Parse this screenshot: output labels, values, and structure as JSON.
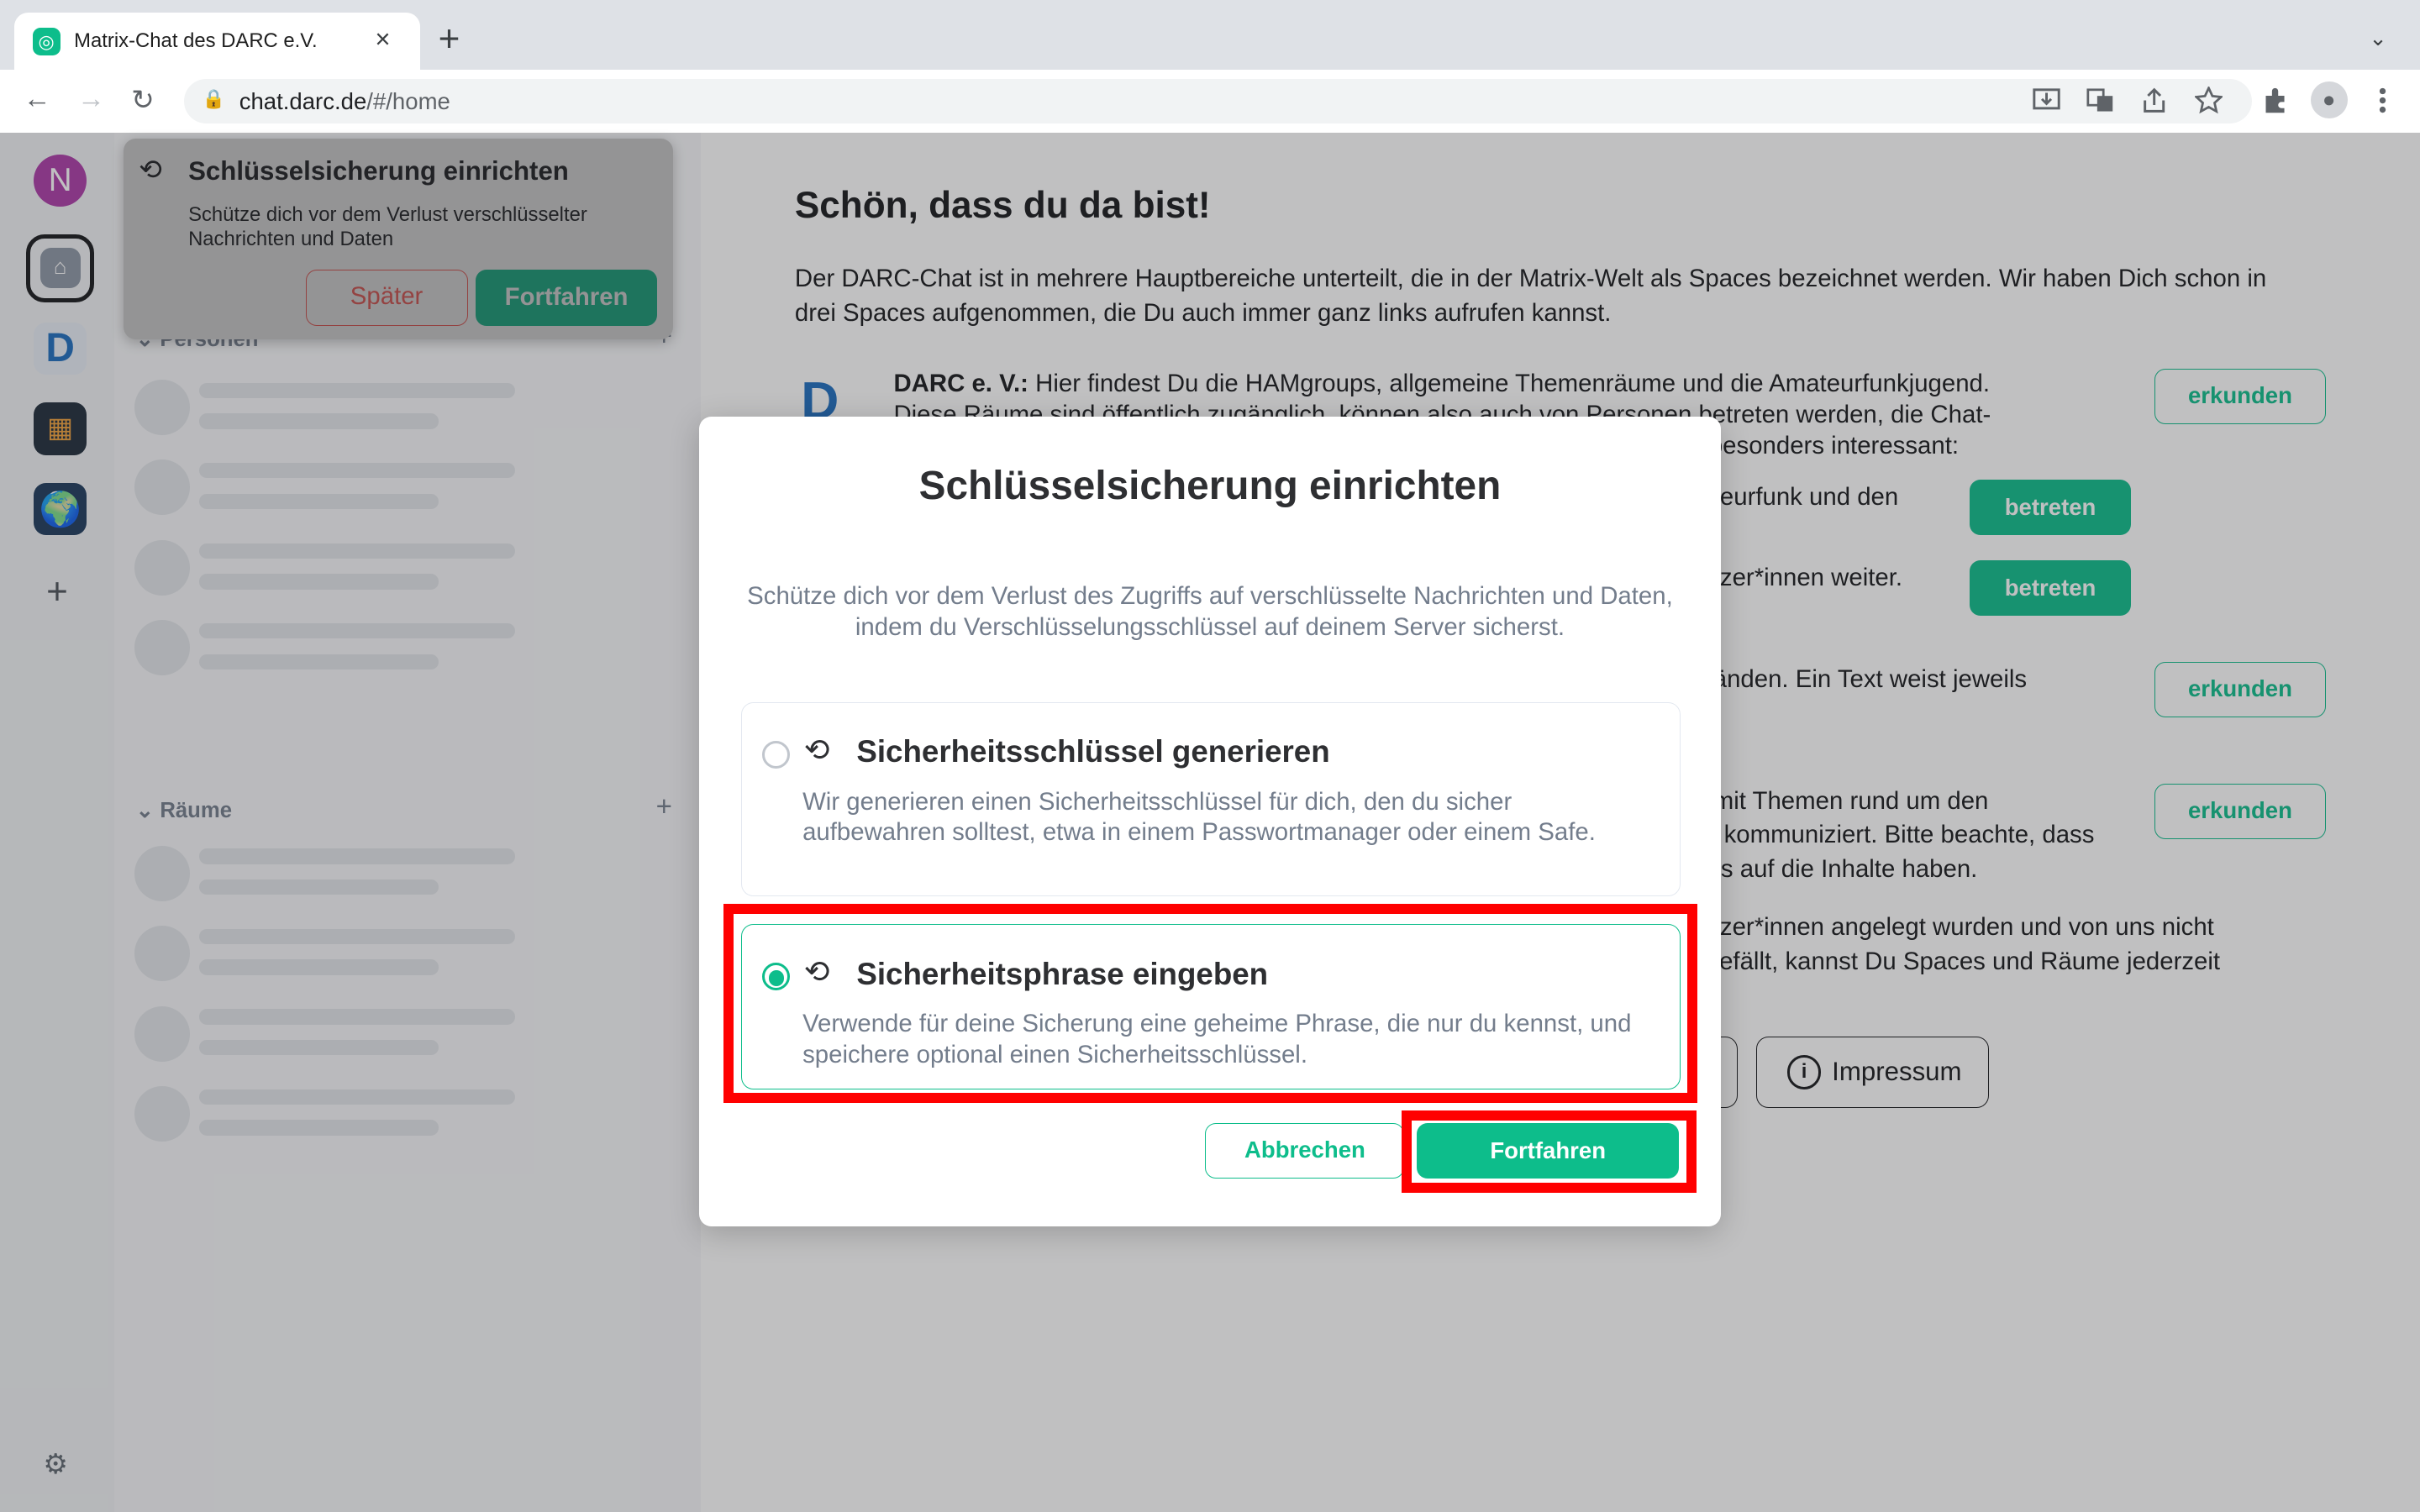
{
  "browser": {
    "tab_title": "Matrix-Chat des DARC e.V.",
    "tab_favicon_text": "◎",
    "close_glyph": "×",
    "newtab_glyph": "+",
    "tabmenu_glyph": "⌄",
    "back_glyph": "←",
    "forward_glyph": "→",
    "reload_glyph": "↻",
    "lock_glyph": "🔒",
    "url_host": "chat.darc.de",
    "url_path": "/#/home",
    "icons": [
      "install-icon",
      "translate-icon",
      "share-icon",
      "bookmark-star-icon",
      "extensions-icon",
      "profile-icon",
      "menu-icon"
    ]
  },
  "spaces": {
    "avatar_letter": "N",
    "home_glyph": "⌂",
    "darc_glyph": "D",
    "map_glyph": "▦",
    "globe_glyph": "🌍",
    "add_glyph": "+",
    "settings_glyph": "⚙"
  },
  "roomlist": {
    "people_label": "Personen",
    "rooms_label": "Räume",
    "chevron": "⌄",
    "add_glyph": "+"
  },
  "toast": {
    "icon_glyph": "⟲",
    "title": "Schlüsselsicherung einrichten",
    "body": "Schütze dich vor dem Verlust verschlüsselter Nachrichten und Daten",
    "later": "Später",
    "continue": "Fortfahren"
  },
  "home": {
    "title": "Schön, dass du da bist!",
    "intro": "Der DARC-Chat ist in mehrere Hauptbereiche unterteilt, die in der Matrix-Welt als Spaces bezeichnet werden. Wir haben Dich schon in drei Spaces aufgenommen, die Du auch immer ganz links aufrufen kannst.",
    "darc_label": "DARC e. V.:",
    "darc_text": " Hier findest Du die HAMgroups, allgemeine Themenräume und die Amateurfunkjugend.",
    "darc_text2": "Diese Räume sind öffentlich zugänglich, können also auch von Personen betreten werden, die Chat-",
    "partial": [
      "e besonders interessant:",
      "teurfunk und den",
      "tzer*innen weiter.",
      "änden. Ein Text weist jeweils",
      "mit Themen rund um den",
      "kommuniziert. Bitte beachte, dass",
      "s auf die Inhalte haben.",
      "tzer*innen angelegt wurden und von uns nicht",
      "efällt, kannst Du Spaces und Räume jederzeit"
    ],
    "explore": "erkunden",
    "join": "betreten",
    "impressum": "Impressum",
    "info_glyph": "i"
  },
  "dialog": {
    "title": "Schlüsselsicherung einrichten",
    "description": "Schütze dich vor dem Verlust des Zugriffs auf verschlüsselte Nachrichten und Daten, indem du Verschlüsselungsschlüssel auf deinem Server sicherst.",
    "option1_title": "Sicherheitsschlüssel generieren",
    "option1_desc": "Wir generieren einen Sicherheitsschlüssel für dich, den du sicher aufbewahren solltest, etwa in einem Passwortmanager oder einem Safe.",
    "option2_title": "Sicherheitsphrase eingeben",
    "option2_desc": "Verwende für deine Sicherung eine geheime Phrase, die nur du kennst, und speichere optional einen Sicherheitsschlüssel.",
    "option_icon": "⟲",
    "selected_option": "Sicherheitsphrase eingeben",
    "cancel": "Abbrechen",
    "continue": "Fortfahren"
  },
  "colors": {
    "accent": "#0dbd8b",
    "alert": "#ff5b55",
    "highlight": "#ff0000"
  }
}
